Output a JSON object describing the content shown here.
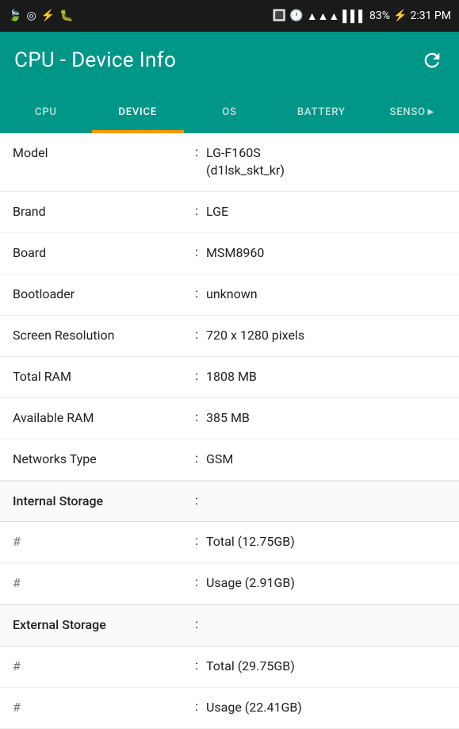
{
  "statusBar": {
    "time": "2:31 PM",
    "battery": "83%",
    "icons": [
      "leaf",
      "target",
      "usb",
      "bug"
    ]
  },
  "header": {
    "title": "CPU - Device Info",
    "refreshLabel": "refresh"
  },
  "tabs": [
    {
      "id": "cpu",
      "label": "CPU",
      "active": false
    },
    {
      "id": "device",
      "label": "DEVICE",
      "active": true
    },
    {
      "id": "os",
      "label": "OS",
      "active": false
    },
    {
      "id": "battery",
      "label": "BATTERY",
      "active": false
    },
    {
      "id": "sensor",
      "label": "SENSO►",
      "active": false
    }
  ],
  "rows": [
    {
      "type": "data",
      "label": "Model",
      "sep": ":",
      "value": "LG-F160S\n(d1lsk_skt_kr)"
    },
    {
      "type": "data",
      "label": "Brand",
      "sep": ":",
      "value": "LGE"
    },
    {
      "type": "data",
      "label": "Board",
      "sep": ":",
      "value": "MSM8960"
    },
    {
      "type": "data",
      "label": "Bootloader",
      "sep": ":",
      "value": "unknown"
    },
    {
      "type": "data",
      "label": "Screen Resolution",
      "sep": ":",
      "value": "720 x 1280 pixels"
    },
    {
      "type": "data",
      "label": "Total RAM",
      "sep": ":",
      "value": "1808 MB"
    },
    {
      "type": "data",
      "label": "Available RAM",
      "sep": ":",
      "value": "385 MB"
    },
    {
      "type": "data",
      "label": "Networks Type",
      "sep": ":",
      "value": "GSM"
    },
    {
      "type": "section",
      "label": "Internal Storage",
      "sep": ":",
      "value": ""
    },
    {
      "type": "hash",
      "label": "#",
      "sep": ":",
      "value": "Total (12.75GB)"
    },
    {
      "type": "hash",
      "label": "#",
      "sep": ":",
      "value": "Usage (2.91GB)"
    },
    {
      "type": "section",
      "label": "External Storage",
      "sep": ":",
      "value": ""
    },
    {
      "type": "hash",
      "label": "#",
      "sep": ":",
      "value": "Total (29.75GB)"
    },
    {
      "type": "hash",
      "label": "#",
      "sep": ":",
      "value": "Usage (22.41GB)"
    }
  ]
}
